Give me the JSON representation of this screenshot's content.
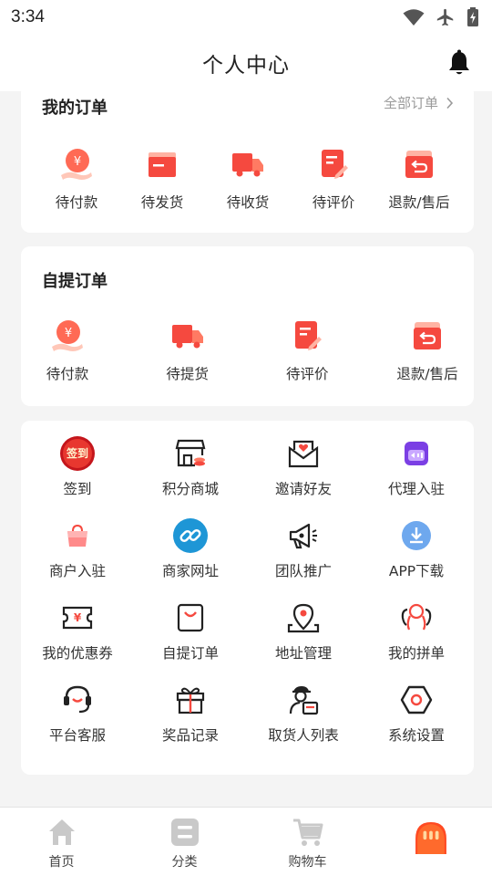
{
  "status_bar": {
    "time": "3:34"
  },
  "header": {
    "title": "个人中心"
  },
  "my_orders": {
    "title": "我的订单",
    "all_link": "全部订单",
    "items": [
      {
        "label": "待付款",
        "icon": "payment-icon"
      },
      {
        "label": "待发货",
        "icon": "ship-box-icon"
      },
      {
        "label": "待收货",
        "icon": "delivery-truck-icon"
      },
      {
        "label": "待评价",
        "icon": "review-icon"
      },
      {
        "label": "退款/售后",
        "icon": "refund-icon"
      }
    ]
  },
  "pickup_orders": {
    "title": "自提订单",
    "items": [
      {
        "label": "待付款",
        "icon": "payment-icon"
      },
      {
        "label": "待提货",
        "icon": "delivery-truck-icon"
      },
      {
        "label": "待评价",
        "icon": "review-icon"
      },
      {
        "label": "退款/售后",
        "icon": "refund-icon"
      }
    ]
  },
  "services": {
    "signin_badge": "签到",
    "items": [
      {
        "label": "签到",
        "icon": "signin-icon"
      },
      {
        "label": "积分商城",
        "icon": "points-mall-icon"
      },
      {
        "label": "邀请好友",
        "icon": "invite-icon"
      },
      {
        "label": "代理入驻",
        "icon": "agent-icon"
      },
      {
        "label": "商户入驻",
        "icon": "merchant-icon"
      },
      {
        "label": "商家网址",
        "icon": "link-icon"
      },
      {
        "label": "团队推广",
        "icon": "megaphone-icon"
      },
      {
        "label": "APP下载",
        "icon": "download-icon"
      },
      {
        "label": "我的优惠券",
        "icon": "coupon-icon"
      },
      {
        "label": "自提订单",
        "icon": "shopping-bag-icon"
      },
      {
        "label": "地址管理",
        "icon": "location-icon"
      },
      {
        "label": "我的拼单",
        "icon": "group-buy-icon"
      },
      {
        "label": "平台客服",
        "icon": "headset-icon"
      },
      {
        "label": "奖品记录",
        "icon": "gift-icon"
      },
      {
        "label": "取货人列表",
        "icon": "pickup-person-icon"
      },
      {
        "label": "系统设置",
        "icon": "settings-icon"
      }
    ]
  },
  "tabbar": {
    "items": [
      {
        "label": "首页",
        "icon": "home-icon"
      },
      {
        "label": "分类",
        "icon": "category-icon"
      },
      {
        "label": "购物车",
        "icon": "cart-icon"
      },
      {
        "label": "",
        "icon": "profile-icon"
      }
    ]
  },
  "colors": {
    "accent": "#f0443c",
    "accent_light": "#ff7a63",
    "background": "#f4f4f4"
  }
}
